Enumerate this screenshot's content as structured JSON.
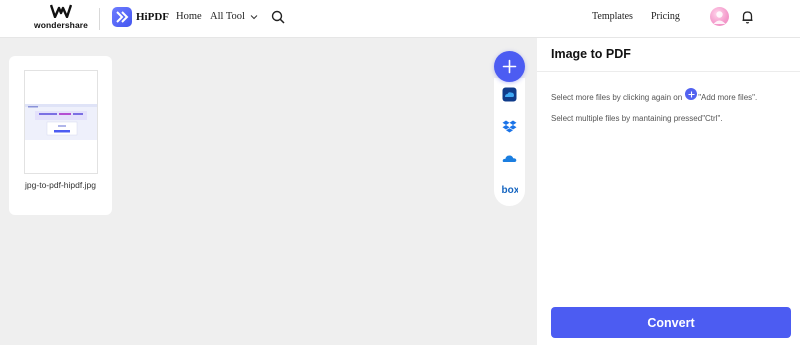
{
  "header": {
    "brand_name": "wondershare",
    "product_name": "HiPDF",
    "nav": {
      "home": "Home",
      "all_tool": "All Tool",
      "templates": "Templates",
      "pricing": "Pricing"
    },
    "icons": [
      "wondershare-logo-icon",
      "hipdf-logo-icon",
      "chevron-down-icon",
      "search-icon",
      "avatar",
      "bell-icon"
    ]
  },
  "file_list": {
    "items": [
      {
        "name": "jpg-to-pdf-hipdf.jpg"
      }
    ]
  },
  "upload_toolbar": {
    "items": [
      "add-icon",
      "google-drive-icon",
      "dropbox-icon",
      "onedrive-icon",
      "box-icon"
    ],
    "box_label": "box"
  },
  "panel": {
    "title": "Image to PDF",
    "hint_1_before": "Select more files by clicking again on ",
    "hint_1_after": "\"Add more files\".",
    "hint_2": "Select multiple files by mantaining pressed\"Ctrl\".",
    "convert_label": "Convert"
  },
  "colors": {
    "accent": "#4c5cf2",
    "panel_bg": "#ffffff",
    "workspace_bg": "#efefef"
  }
}
